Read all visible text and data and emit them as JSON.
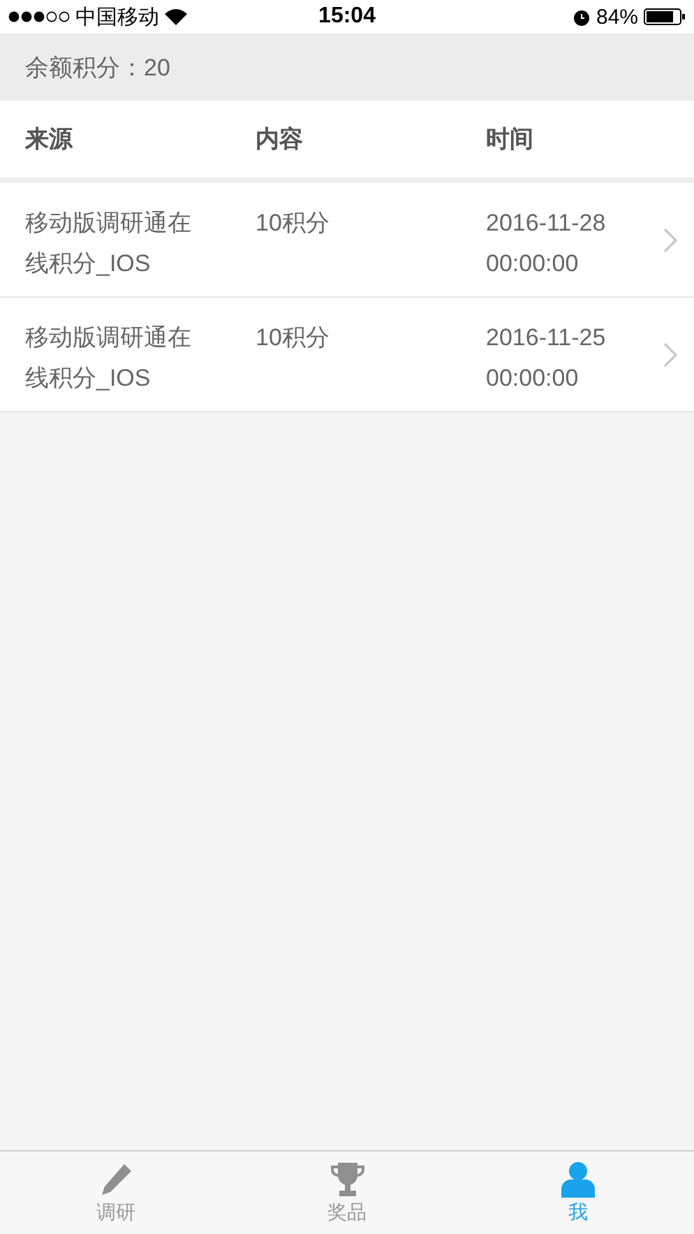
{
  "status_bar": {
    "carrier": "中国移动",
    "time": "15:04",
    "battery": "84%"
  },
  "balance": "余额积分：20",
  "table": {
    "columns": [
      "来源",
      "内容",
      "时间"
    ],
    "rows": [
      {
        "source": "移动版调研通在线积分_IOS",
        "content": "10积分",
        "time": "2016-11-28 00:00:00"
      },
      {
        "source": "移动版调研通在线积分_IOS",
        "content": "10积分",
        "time": "2016-11-25 00:00:00"
      }
    ]
  },
  "tab_bar": [
    {
      "label": "调研",
      "kind": "pencil",
      "selected": false
    },
    {
      "label": "奖品",
      "kind": "trophy",
      "selected": false
    },
    {
      "label": "我",
      "kind": "person",
      "selected": true
    }
  ]
}
